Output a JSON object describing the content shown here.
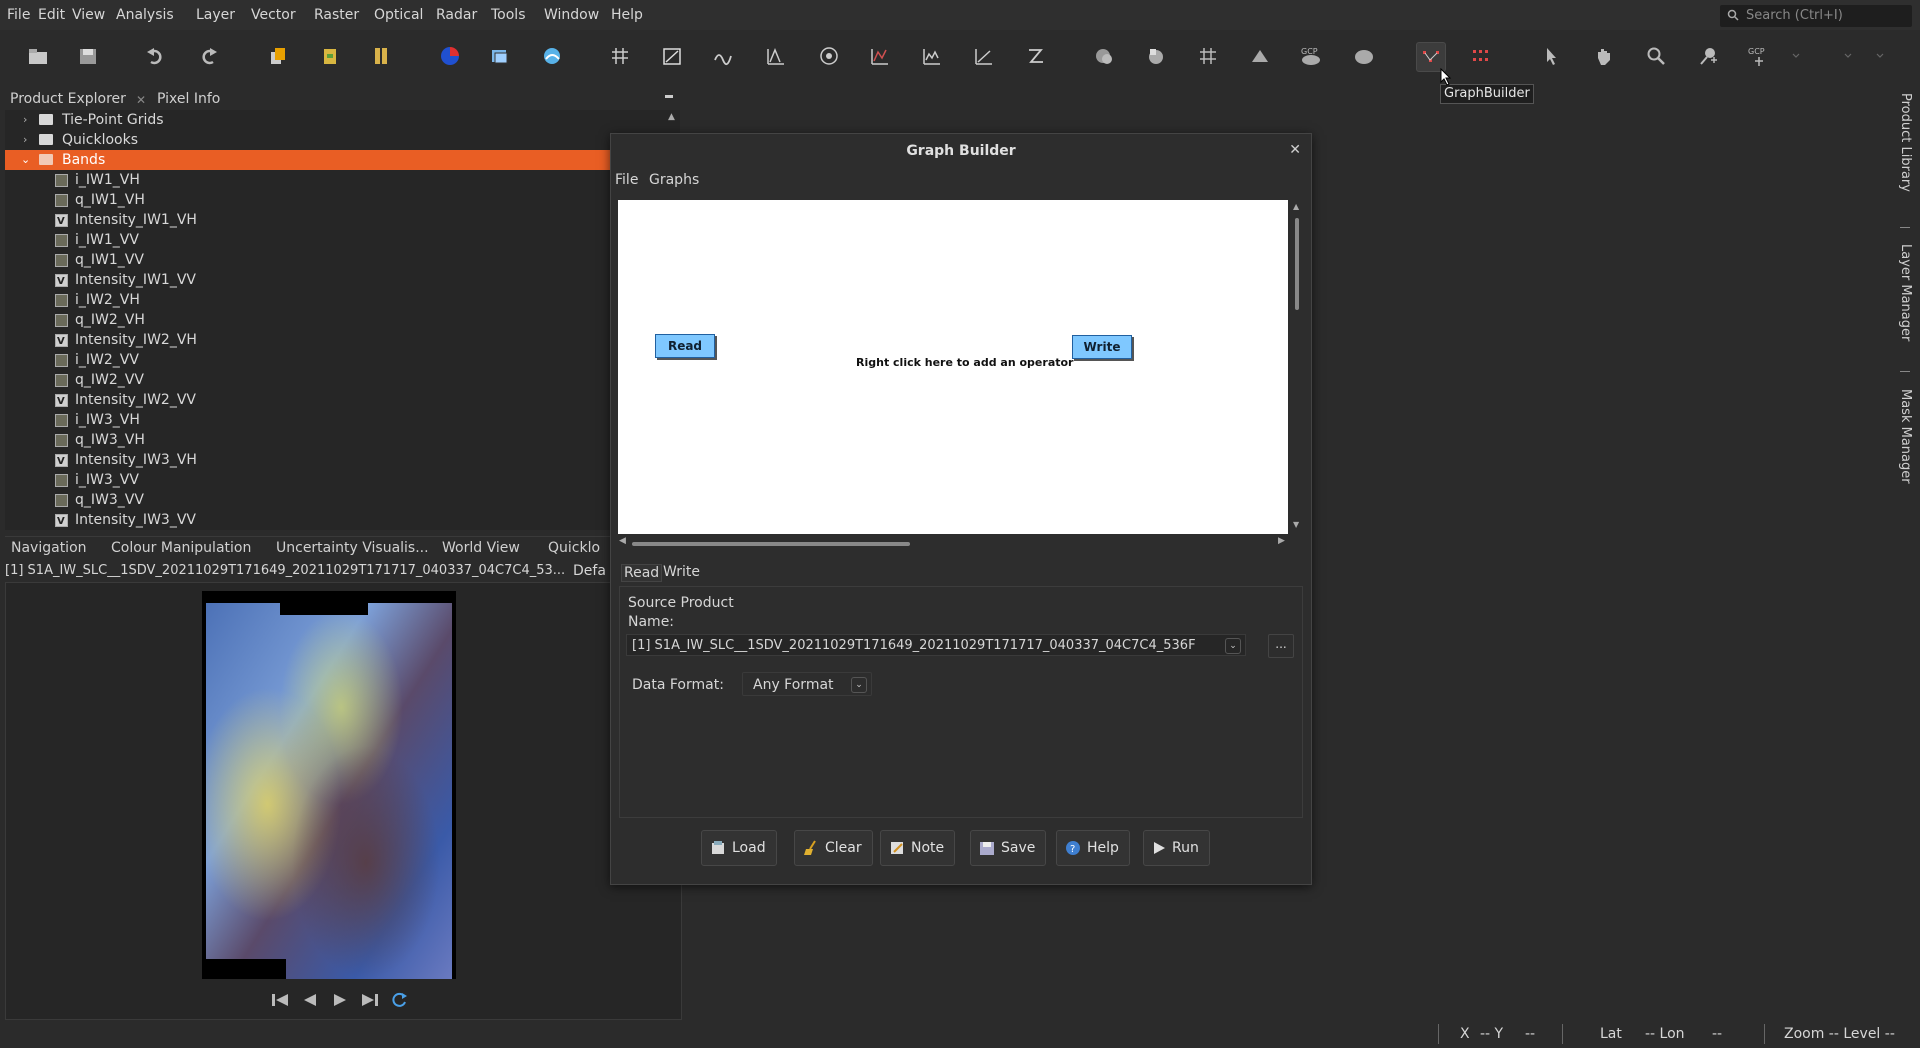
{
  "menubar": {
    "items": [
      "File",
      "Edit",
      "View",
      "Analysis",
      "Layer",
      "Vector",
      "Raster",
      "Optical",
      "Radar",
      "Tools",
      "Window",
      "Help"
    ],
    "search_placeholder": "Search (Ctrl+I)"
  },
  "toolbar": {
    "tooltip": "GraphBuilder"
  },
  "product_explorer": {
    "tabs": [
      "Product Explorer",
      "Pixel Info"
    ],
    "folders": [
      "Tie-Point Grids",
      "Quicklooks",
      "Bands"
    ],
    "bands": [
      "i_IW1_VH",
      "q_IW1_VH",
      "Intensity_IW1_VH",
      "i_IW1_VV",
      "q_IW1_VV",
      "Intensity_IW1_VV",
      "i_IW2_VH",
      "q_IW2_VH",
      "Intensity_IW2_VH",
      "i_IW2_VV",
      "q_IW2_VV",
      "Intensity_IW2_VV",
      "i_IW3_VH",
      "q_IW3_VH",
      "Intensity_IW3_VH",
      "i_IW3_VV",
      "q_IW3_VV",
      "Intensity_IW3_VV"
    ]
  },
  "navigation": {
    "tabs": [
      "Navigation",
      "Colour Manipulation",
      "Uncertainty Visualis...",
      "World View",
      "Quicklo"
    ],
    "product_label": "[1] S1A_IW_SLC__1SDV_20211029T171649_20211029T171717_040337_04C7C4_53...",
    "default_label": "Defa"
  },
  "graph_builder": {
    "title": "Graph Builder",
    "menu": [
      "File",
      "Graphs"
    ],
    "nodes": {
      "read": "Read",
      "write": "Write"
    },
    "canvas_hint": "Right click here to add an operator",
    "op_tabs": [
      "Read",
      "Write"
    ],
    "source_product": {
      "group_title": "Source Product",
      "name_label": "Name:",
      "name_value": "[1] S1A_IW_SLC__1SDV_20211029T171649_20211029T171717_040337_04C7C4_536F",
      "browse": "...",
      "format_label": "Data Format:",
      "format_value": "Any Format"
    },
    "buttons": {
      "load": "Load",
      "clear": "Clear",
      "note": "Note",
      "save": "Save",
      "help": "Help",
      "run": "Run"
    }
  },
  "right_rail": [
    "Product Library",
    "Layer Manager",
    "Mask Manager"
  ],
  "statusbar": {
    "x": "X",
    "x_val": "-- Y",
    "y_val": "--",
    "lat": "Lat",
    "lat_val": "-- Lon",
    "lon_val": "--",
    "zoom": "Zoom -- Level --"
  }
}
